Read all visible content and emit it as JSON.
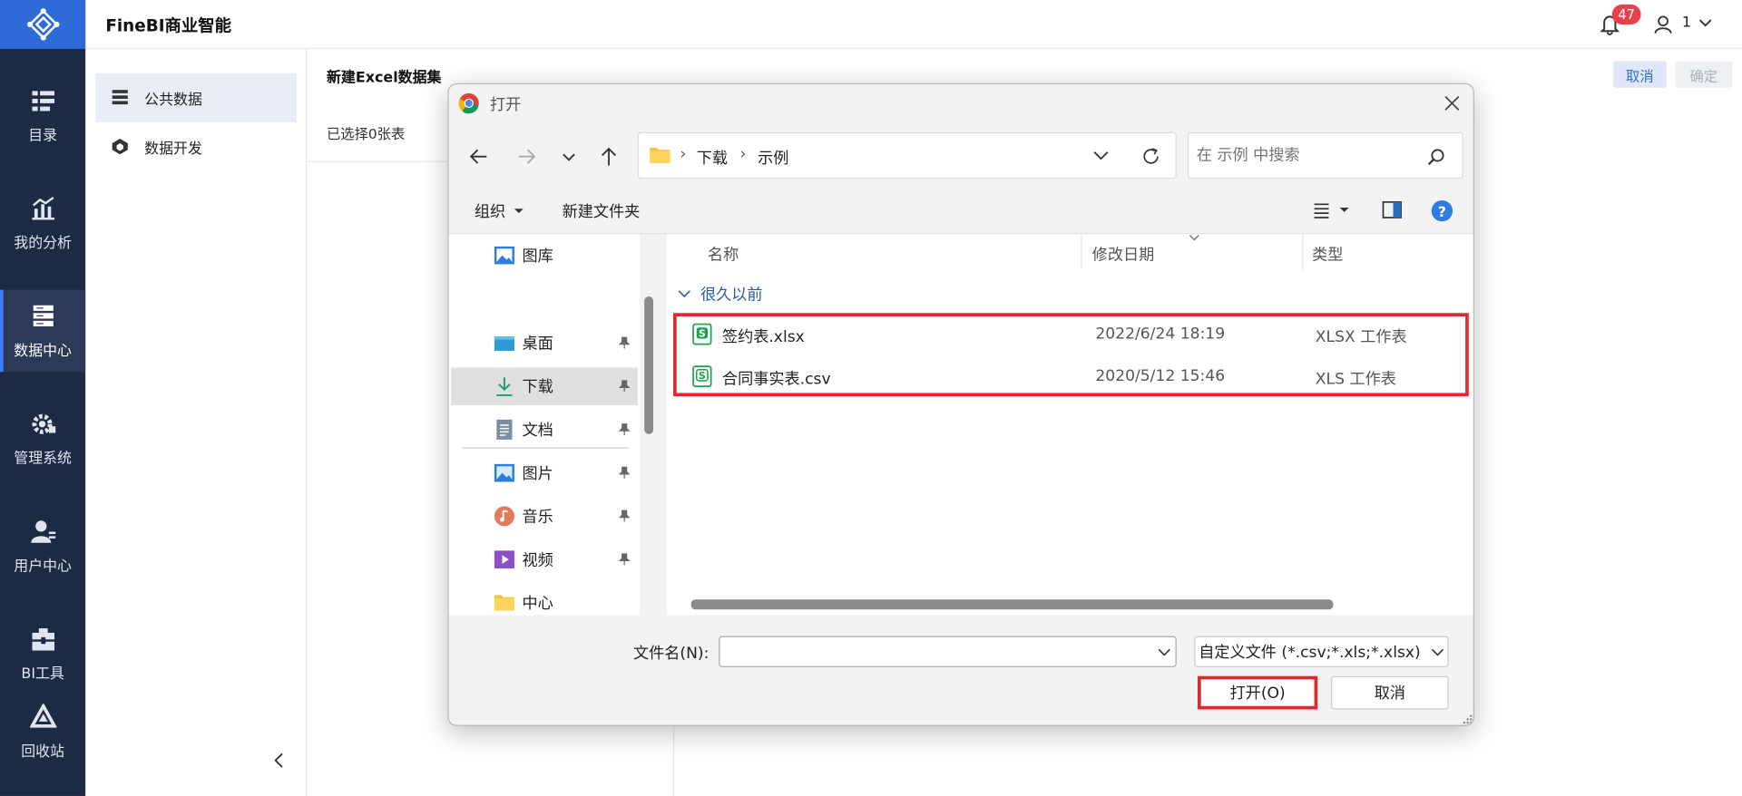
{
  "app": {
    "title": "FineBI商业智能",
    "notification_count": "47",
    "user_name": "1"
  },
  "leftnav": {
    "items": [
      {
        "label": "目录",
        "icon": "catalog-icon"
      },
      {
        "label": "我的分析",
        "icon": "analysis-icon"
      },
      {
        "label": "数据中心",
        "icon": "data-center-icon",
        "active": true
      },
      {
        "label": "管理系统",
        "icon": "gear-icon"
      },
      {
        "label": "用户中心",
        "icon": "user-icon"
      },
      {
        "label": "BI工具",
        "icon": "toolbox-icon"
      },
      {
        "label": "回收站",
        "icon": "recycle-icon"
      }
    ]
  },
  "sidebar2": {
    "items": [
      {
        "label": "公共数据",
        "active": true
      },
      {
        "label": "数据开发"
      }
    ]
  },
  "content": {
    "title": "新建Excel数据集",
    "selected_count": "已选择0张表",
    "cancel_label": "取消",
    "confirm_label": "确定"
  },
  "dialog": {
    "title": "打开",
    "breadcrumb": [
      "下载",
      "示例"
    ],
    "search_placeholder": "在 示例 中搜索",
    "organize_label": "组织",
    "new_folder_label": "新建文件夹",
    "nav_items": [
      {
        "label": "图库",
        "icon": "gallery-icon",
        "pinned": false
      },
      {
        "label": "桌面",
        "icon": "desktop-icon",
        "pinned": true
      },
      {
        "label": "下载",
        "icon": "download-icon",
        "pinned": true,
        "selected": true
      },
      {
        "label": "文档",
        "icon": "document-icon",
        "pinned": true
      },
      {
        "label": "图片",
        "icon": "pictures-icon",
        "pinned": true
      },
      {
        "label": "音乐",
        "icon": "music-icon",
        "pinned": true
      },
      {
        "label": "视频",
        "icon": "video-icon",
        "pinned": true
      },
      {
        "label": "中心",
        "icon": "folder-icon",
        "pinned": false
      }
    ],
    "columns": {
      "name": "名称",
      "modified": "修改日期",
      "type": "类型"
    },
    "group_label": "很久以前",
    "files": [
      {
        "name": "签约表.xlsx",
        "modified": "2022/6/24 18:19",
        "type": "XLSX 工作表"
      },
      {
        "name": "合同事实表.csv",
        "modified": "2020/5/12 15:46",
        "type": "XLS 工作表"
      }
    ],
    "filename_label": "文件名(N):",
    "filename_value": "",
    "filetype_value": "自定义文件 (*.csv;*.xls;*.xlsx)",
    "open_label": "打开(O)",
    "cancel_label": "取消"
  },
  "colors": {
    "nav_bg": "#1d2a44",
    "brand": "#2f6bd8",
    "highlight": "#e0282e"
  }
}
